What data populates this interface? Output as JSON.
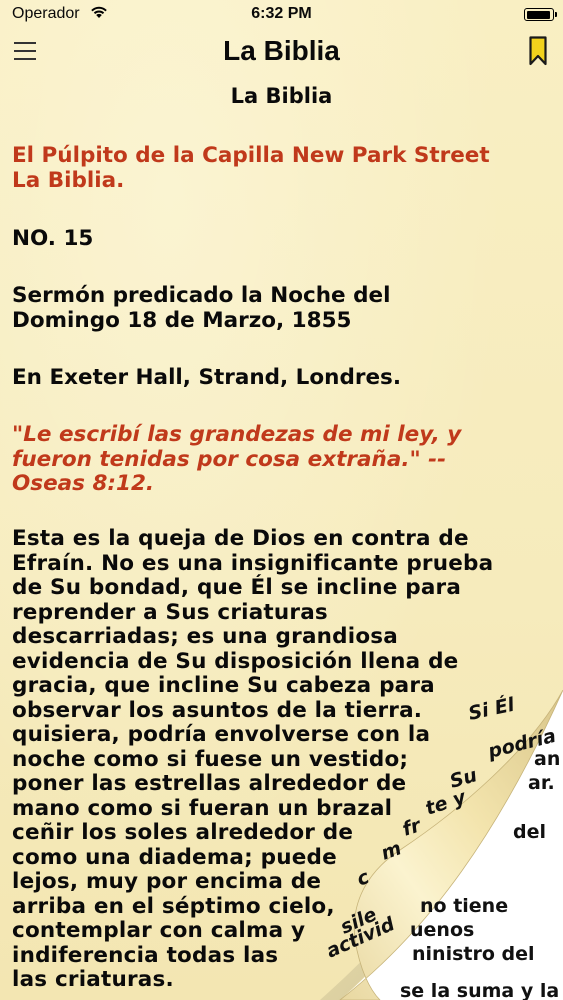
{
  "status_bar": {
    "carrier": "Operador",
    "time": "6:32 PM",
    "battery_level": 0.95
  },
  "nav": {
    "title": "La Biblia",
    "menu_icon": "hamburger-menu-icon",
    "bookmark_icon": "bookmark-icon"
  },
  "article": {
    "subtitle": "La Biblia",
    "header_red": "El Púlpito de la Capilla New Park Street\nLa Biblia.",
    "number": "NO. 15",
    "preached": "Sermón predicado la Noche del\nDomingo 18 de Marzo, 1855",
    "location": "En Exeter Hall, Strand, Londres.",
    "verse": "\"Le escribí las grandezas de mi ley, y\nfueron tenidas por cosa extraña.\" --\nOseas 8:12.",
    "body": "Esta es la queja de Dios en contra de\nEfraín. No es una insignificante prueba\nde Su bondad, que Él se incline para\nreprender a Sus criaturas\ndescarriadas; es una grandiosa\nevidencia de Su disposición llena de\ngracia, que incline Su cabeza para\nobservar los asuntos de la tierra.\nquisiera, podría envolverse con la\nnoche como si fuese un vestido;\nponer las estrellas alrededor de\nmano como si fueran un brazal\nceñir los soles alrededor de\ncomo una diadema; puede\nlejos, muy por encima de\narriba en el séptimo cielo,\ncontemplar con calma y\nindiferencia todas las\nlas criaturas.",
    "curl_fragments": [
      "Si Él",
      "podría",
      "an",
      "Su",
      "ar.",
      "te y",
      "fr",
      "del",
      "m",
      "c",
      "no tiene",
      "sile",
      "uenos",
      "activid",
      "ninistro del",
      "se la suma y la"
    ]
  },
  "colors": {
    "background": "#f8eebe",
    "accent_red": "#c0391b",
    "bookmark_yellow": "#f2d21c"
  }
}
